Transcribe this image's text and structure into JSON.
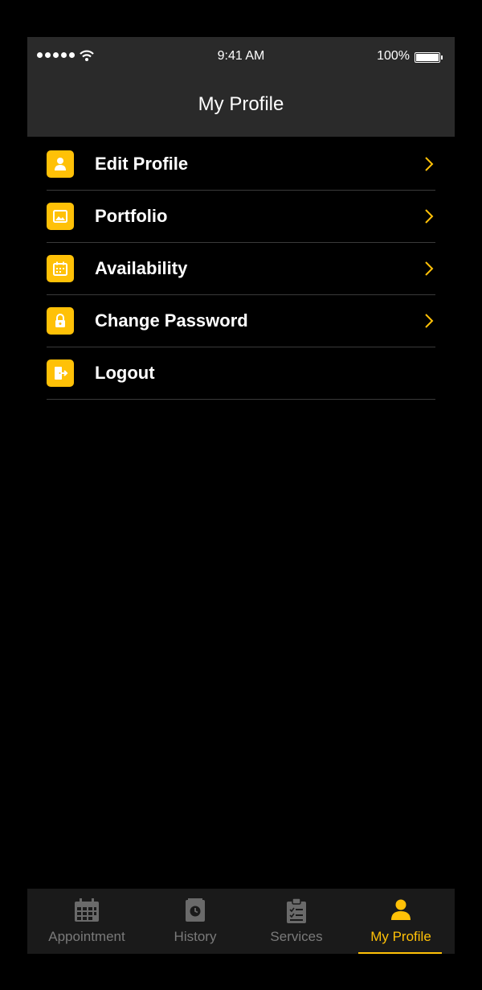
{
  "status_bar": {
    "time": "9:41 AM",
    "battery": "100%"
  },
  "header": {
    "title": "My Profile"
  },
  "menu": {
    "items": [
      {
        "label": "Edit Profile",
        "icon": "user-icon",
        "chevron": true
      },
      {
        "label": "Portfolio",
        "icon": "image-icon",
        "chevron": true
      },
      {
        "label": "Availability",
        "icon": "calendar-icon",
        "chevron": true
      },
      {
        "label": "Change Password",
        "icon": "lock-icon",
        "chevron": true
      },
      {
        "label": "Logout",
        "icon": "logout-icon",
        "chevron": false
      }
    ]
  },
  "tabs": [
    {
      "label": "Appointment",
      "icon": "calendar-grid-icon",
      "active": false
    },
    {
      "label": "History",
      "icon": "history-icon",
      "active": false
    },
    {
      "label": "Services",
      "icon": "clipboard-icon",
      "active": false
    },
    {
      "label": "My Profile",
      "icon": "person-icon",
      "active": true
    }
  ],
  "colors": {
    "accent": "#ffc107",
    "bar_bg": "#2a2a2a",
    "tab_inactive": "#7a7a7a"
  }
}
